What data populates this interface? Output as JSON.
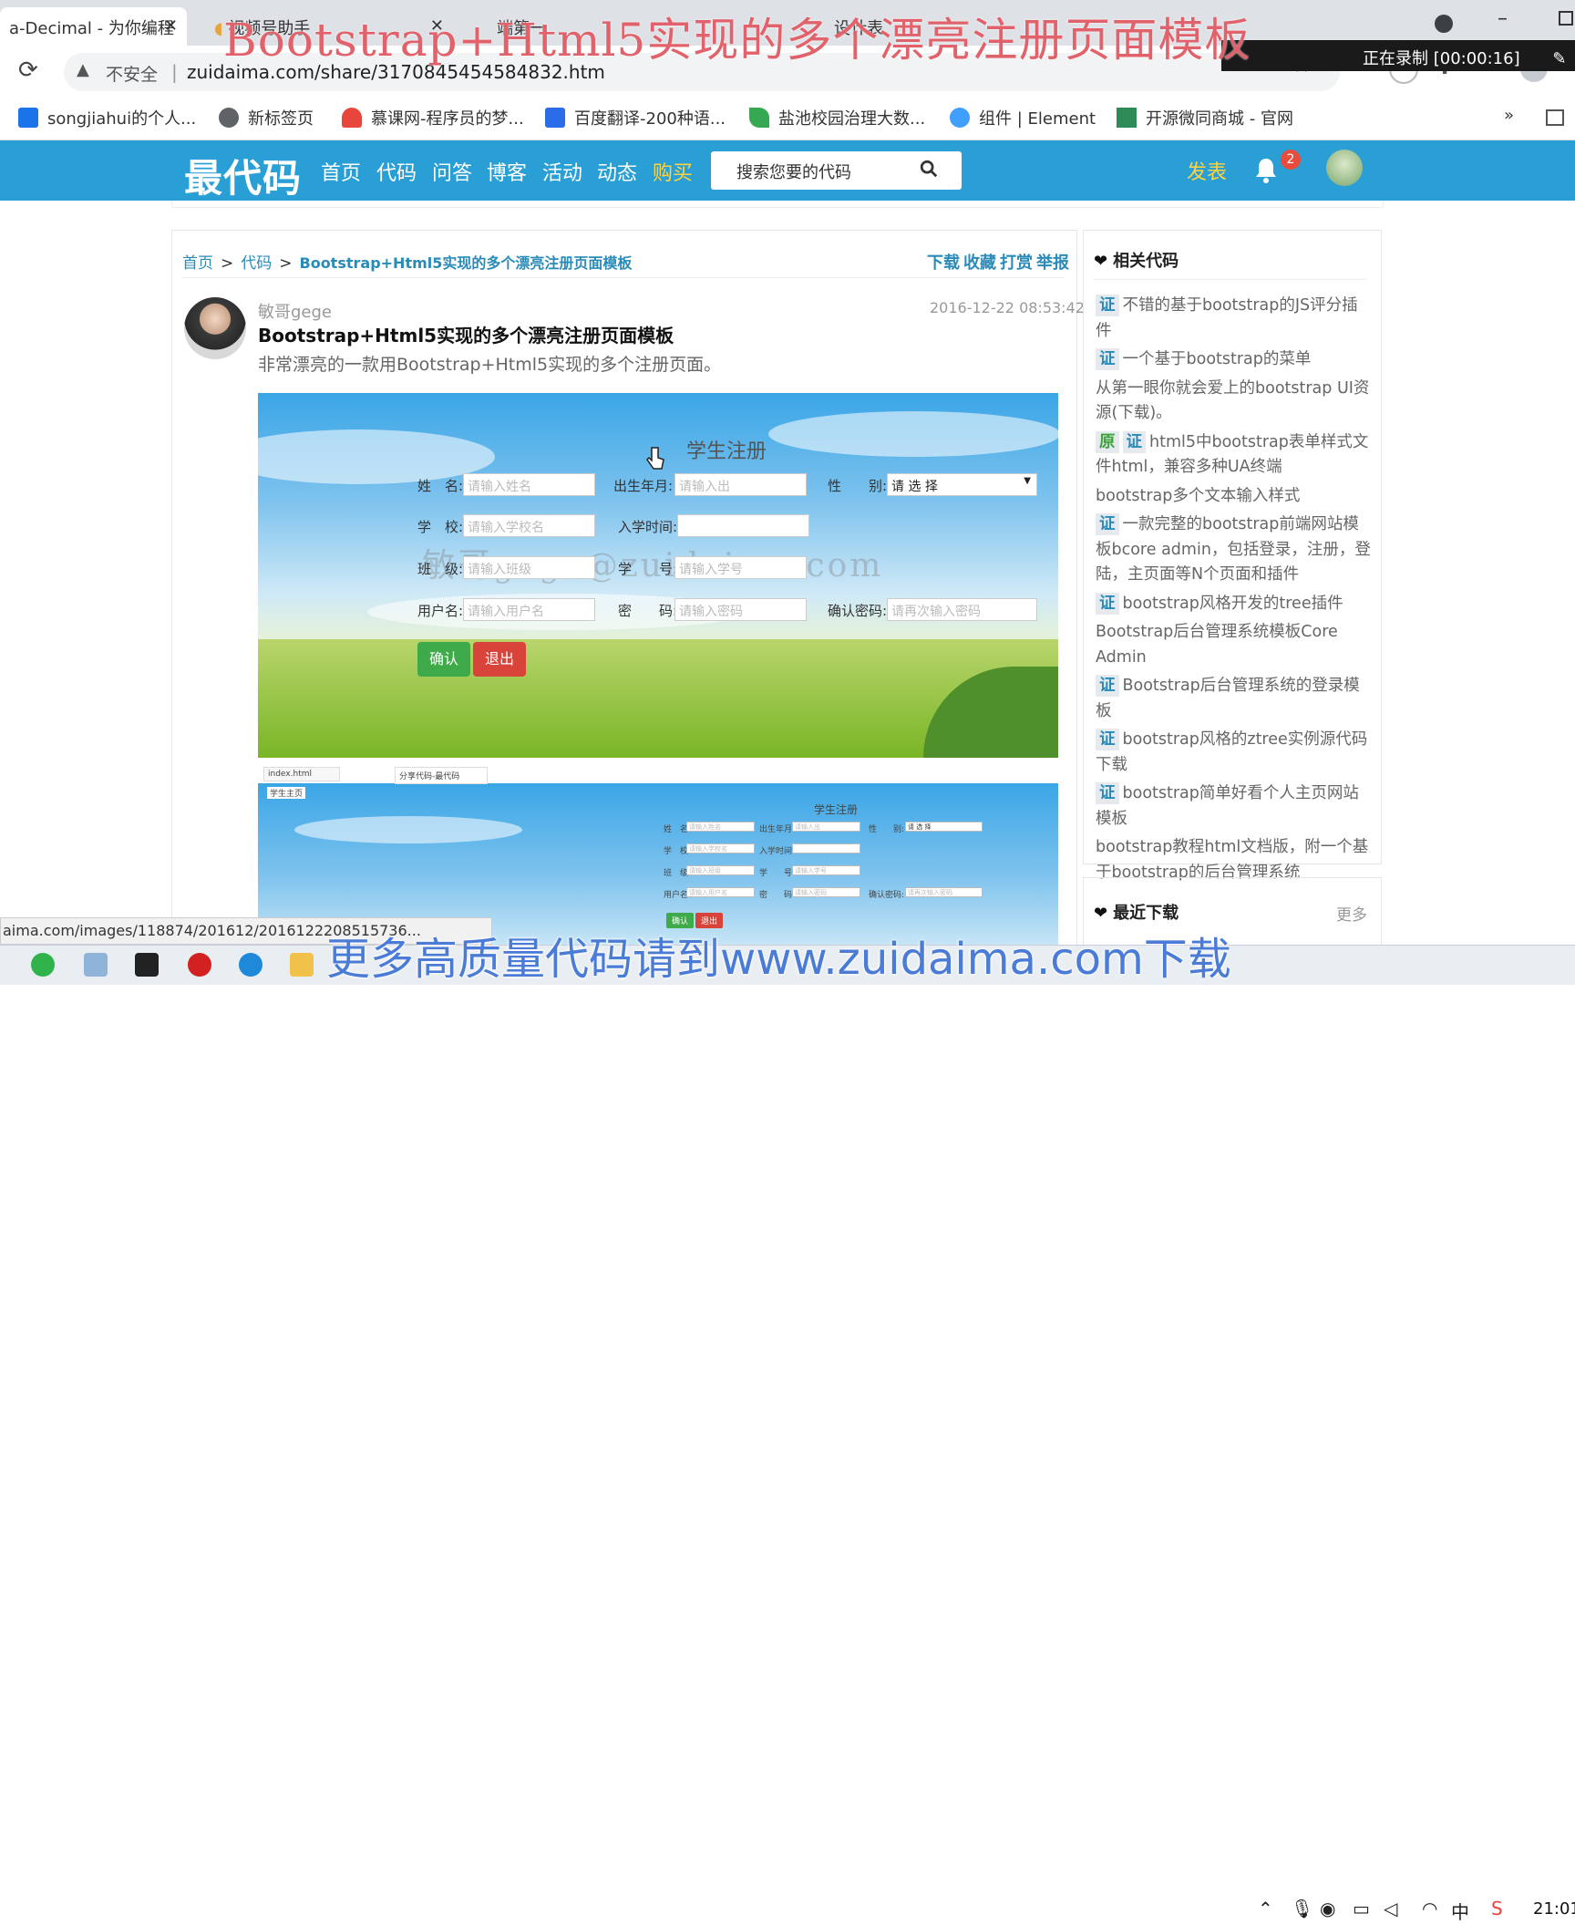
{
  "overlay": {
    "title": "Bootstrap+Html5实现的多个漂亮注册页面模板",
    "recording": "正在录制 [00:00:16]",
    "bottom_banner": "更多高质量代码请到www.zuidaima.com下载"
  },
  "browser": {
    "tabs": [
      {
        "label": "a-Decimal - 为你编程",
        "close": "✕"
      },
      {
        "label": "视频号助手",
        "close": "✕"
      },
      {
        "label": "端第一",
        "close": "✕"
      },
      {
        "label": "设计表",
        "close": "✕"
      }
    ],
    "insecure_label": "不安全",
    "url": "zuidaima.com/share/3170845454584832.htm",
    "bookmarks": [
      {
        "label": "songjiahui的个人...",
        "icon": "blue-square-icon",
        "color": "#1a73e8"
      },
      {
        "label": "新标签页",
        "icon": "globe-icon",
        "color": "#5f6368"
      },
      {
        "label": "慕课网-程序员的梦...",
        "icon": "flame-icon",
        "color": "#e8453c"
      },
      {
        "label": "百度翻译-200种语...",
        "icon": "translate-icon",
        "color": "#2b6de8"
      },
      {
        "label": "盐池校园治理大数...",
        "icon": "leaf-icon",
        "color": "#36a852"
      },
      {
        "label": "组件 | Element",
        "icon": "element-icon",
        "color": "#409eff"
      },
      {
        "label": "开源微同商城 - 官网",
        "icon": "shop-icon",
        "color": "#2e8b57"
      }
    ],
    "bookmarks_more": "»",
    "status_url": "aima.com/images/118874/201612/2016122208515736..."
  },
  "site": {
    "logo": "最代码",
    "nav": [
      "首页",
      "代码",
      "问答",
      "博客",
      "活动",
      "动态",
      "购买"
    ],
    "search_placeholder": "搜索您要的代码",
    "publish": "发表",
    "badge": "2"
  },
  "breadcrumb": {
    "home": "首页",
    "code": "代码",
    "current": "Bootstrap+Html5实现的多个漂亮注册页面模板",
    "sep": ">"
  },
  "actions": [
    "下载",
    "收藏",
    "打赏",
    "举报"
  ],
  "post": {
    "author": "敏哥gege",
    "date": "2016-12-22 08:53:42",
    "title": "Bootstrap+Html5实现的多个漂亮注册页面模板",
    "description": "非常漂亮的一款用Bootstrap+Html5实现的多个注册页面。"
  },
  "preview": {
    "title": "学生注册",
    "watermark": "敏哥gege@zuidaima.com",
    "labels": {
      "name": "姓　名:",
      "birth": "出生年月:",
      "gender": "性　　别:",
      "school": "学　校:",
      "enroll": "入学时间:",
      "class": "班　级:",
      "stuno": "学　　号:",
      "username": "用户名:",
      "password": "密　　码:",
      "confirm": "确认密码:"
    },
    "placeholders": {
      "name": "请输入姓名",
      "birth": "请输入出",
      "gender": "请 选 择",
      "school": "请输入学校名",
      "class": "请输入班级",
      "stuno": "请输入学号",
      "username": "请输入用户名",
      "password": "请输入密码",
      "confirm": "请再次输入密码"
    },
    "confirm_btn": "确认",
    "exit_btn": "退出",
    "mini_tabs": [
      "index.html",
      "分享代码-最代码"
    ],
    "mini_caption": "学生主页"
  },
  "sidebar": {
    "heading": "相关代码",
    "items": [
      {
        "tags": [
          "证"
        ],
        "text": "不错的基于bootstrap的JS评分插件"
      },
      {
        "tags": [
          "证"
        ],
        "text": "一个基于bootstrap的菜单"
      },
      {
        "tags": [],
        "text": "从第一眼你就会爱上的bootstrap UI资源(下载)。"
      },
      {
        "tags": [
          "原",
          "证"
        ],
        "text": "html5中bootstrap表单样式文件html，兼容多种UA终端"
      },
      {
        "tags": [],
        "text": "bootstrap多个文本输入样式"
      },
      {
        "tags": [
          "证"
        ],
        "text": "一款完整的bootstrap前端网站模板bcore admin，包括登录，注册，登陆，主页面等N个页面和插件"
      },
      {
        "tags": [
          "证"
        ],
        "text": "bootstrap风格开发的tree插件"
      },
      {
        "tags": [],
        "text": "Bootstrap后台管理系统模板Core Admin"
      },
      {
        "tags": [
          "证"
        ],
        "text": "Bootstrap后台管理系统的登录模板"
      },
      {
        "tags": [
          "证"
        ],
        "text": "bootstrap风格的ztree实例源代码下载"
      },
      {
        "tags": [
          "证"
        ],
        "text": "bootstrap简单好看个人主页网站模板"
      },
      {
        "tags": [],
        "text": "bootstrap教程html文档版，附一个基于bootstrap的后台管理系统"
      }
    ],
    "recent_heading": "最近下载",
    "recent_more": "更多"
  },
  "taskbar": {
    "clock": "21:01",
    "ime": "中"
  }
}
